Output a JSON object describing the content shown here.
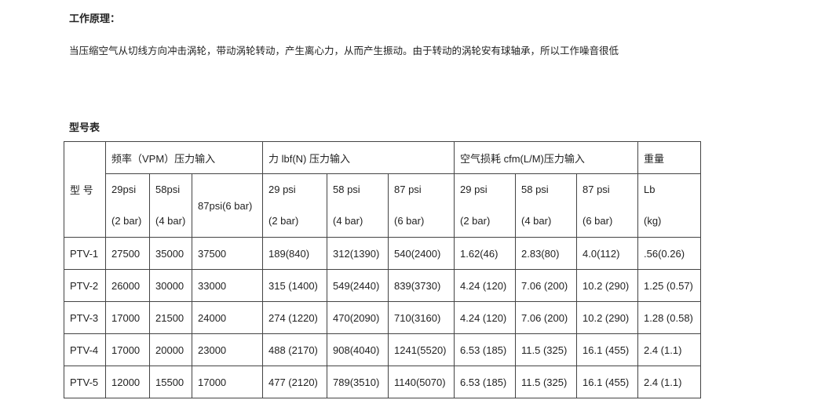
{
  "section_principle": {
    "heading": "工作原理：",
    "text": "当压缩空气从切线方向冲击涡轮，带动涡轮转动，产生离心力，从而产生振动。由于转动的涡轮安有球轴承，所以工作噪音很低"
  },
  "section_models": {
    "heading": "型号表"
  },
  "table": {
    "model_header": "型 号",
    "group_headers": [
      "频率（VPM）压力输入",
      "力 lbf(N)  压力输入",
      "空气损耗 cfm(L/M)压力输入",
      "重量"
    ],
    "sub_headers": [
      {
        "top": "29psi",
        "bottom": "(2 bar)"
      },
      {
        "top": "58psi",
        "bottom": "(4 bar)"
      },
      {
        "top": "87psi(6 bar)",
        "bottom": ""
      },
      {
        "top": "29 psi",
        "bottom": "(2 bar)"
      },
      {
        "top": "58 psi",
        "bottom": "(4 bar)"
      },
      {
        "top": "87 psi",
        "bottom": "(6 bar)"
      },
      {
        "top": "29 psi",
        "bottom": "(2 bar)"
      },
      {
        "top": "58 psi",
        "bottom": "(4 bar)"
      },
      {
        "top": "87 psi",
        "bottom": "(6 bar)"
      },
      {
        "top": "Lb",
        "bottom": "(kg)"
      }
    ],
    "rows": [
      [
        "PTV-1",
        "27500",
        "35000",
        "37500",
        "189(840)",
        "312(1390)",
        "540(2400)",
        "1.62(46)",
        "2.83(80)",
        "4.0(112)",
        ".56(0.26)"
      ],
      [
        "PTV-2",
        "26000",
        "30000",
        "33000",
        "315 (1400)",
        "549(2440)",
        "839(3730)",
        "4.24 (120)",
        "7.06 (200)",
        "10.2 (290)",
        "1.25 (0.57)"
      ],
      [
        "PTV-3",
        "17000",
        "21500",
        "24000",
        "274 (1220)",
        "470(2090)",
        "710(3160)",
        "4.24 (120)",
        "7.06 (200)",
        "10.2 (290)",
        "1.28 (0.58)"
      ],
      [
        "PTV-4",
        "17000",
        "20000",
        "23000",
        "488 (2170)",
        "908(4040)",
        "1241(5520)",
        "6.53 (185)",
        "11.5 (325)",
        "16.1 (455)",
        "2.4 (1.1)"
      ],
      [
        "PTV-5",
        "12000",
        "15500",
        "17000",
        "477 (2120)",
        "789(3510)",
        "1140(5070)",
        "6.53 (185)",
        "11.5 (325)",
        "16.1 (455)",
        "2.4 (1.1)"
      ]
    ]
  }
}
